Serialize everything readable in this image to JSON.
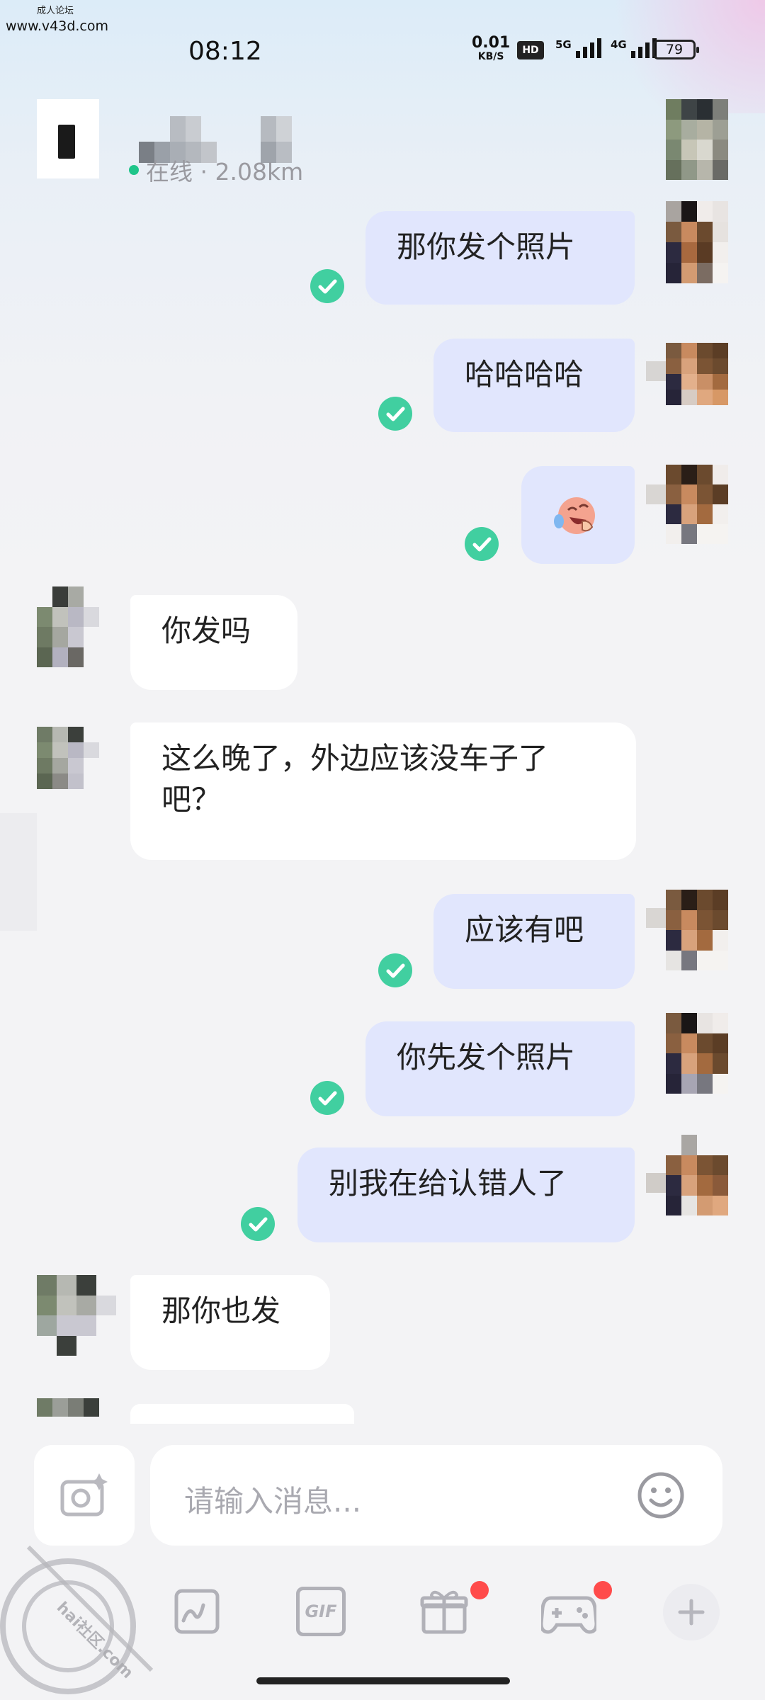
{
  "watermark": {
    "line1": "成人论坛",
    "line2": "www.v43d.com",
    "bottom_text": "hai社区.com"
  },
  "status_bar": {
    "time": "08:12",
    "net_speed_value": "0.01",
    "net_speed_unit": "KB/S",
    "hd_label": "HD",
    "signal1_label": "5G",
    "signal2_label": "4G",
    "battery": "79"
  },
  "header": {
    "status": "在线 · 2.08km",
    "status_color": "#1fc58a"
  },
  "messages": [
    {
      "dir": "out",
      "text": "那你发个照片"
    },
    {
      "dir": "out",
      "text": "哈哈哈哈"
    },
    {
      "dir": "out",
      "emoji": "laughing-tears-emoji"
    },
    {
      "dir": "in",
      "text": "你发吗"
    },
    {
      "dir": "in",
      "text": "这么晚了，外边应该没车子了吧？"
    },
    {
      "dir": "out",
      "text": "应该有吧"
    },
    {
      "dir": "out",
      "text": "你先发个照片"
    },
    {
      "dir": "out",
      "text": "别我在给认错人了"
    },
    {
      "dir": "in",
      "text": "那你也发"
    }
  ],
  "input": {
    "placeholder": "请输入消息..."
  },
  "toolbar": {
    "gif_label": "GIF"
  },
  "colors": {
    "out_bubble": "#e1e6fd",
    "in_bubble": "#ffffff",
    "read_check": "#41cfa0",
    "badge": "#ff4b4b"
  },
  "icons": [
    "back-icon",
    "camera-icon",
    "smile-icon",
    "sketch-icon",
    "gif-icon",
    "gift-icon",
    "gamepad-icon",
    "plus-icon",
    "read-check-icon"
  ]
}
